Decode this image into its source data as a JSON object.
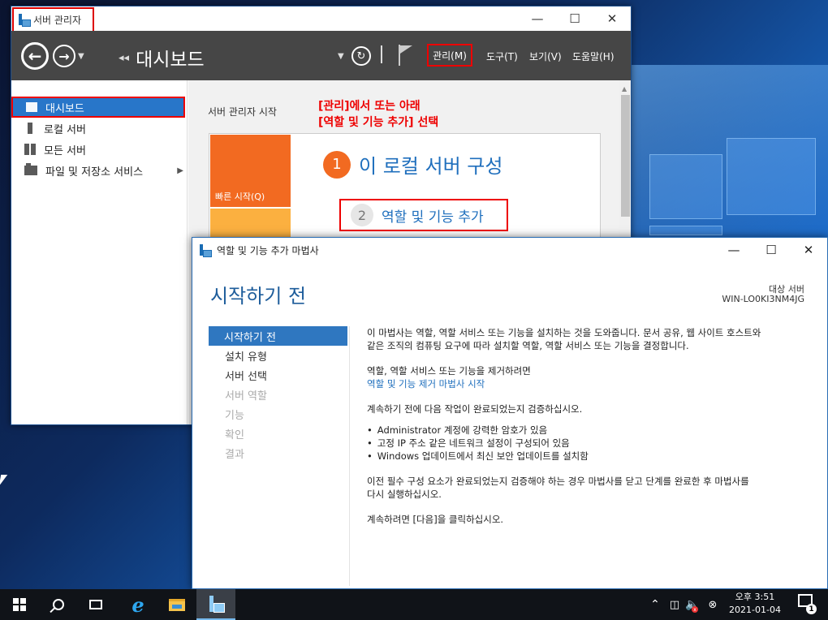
{
  "server_manager": {
    "title": "서버 관리자",
    "breadcrumb_chevron": "◂◂",
    "breadcrumb": "대시보드",
    "menus": [
      {
        "label": "관리(M)"
      },
      {
        "label": "도구(T)"
      },
      {
        "label": "보기(V)"
      },
      {
        "label": "도움말(H)"
      }
    ],
    "sidebar": [
      {
        "label": "대시보드",
        "icon": "dashboard-icon",
        "active": true
      },
      {
        "label": "로컬 서버",
        "icon": "local-server-icon"
      },
      {
        "label": "모든 서버",
        "icon": "all-servers-icon"
      },
      {
        "label": "파일 및 저장소 서비스",
        "icon": "file-storage-icon",
        "has_arrow": true
      }
    ],
    "quickstart": {
      "section_title": "서버 관리자 시작",
      "tile_label": "빠른 시작(Q)",
      "step1_number": "1",
      "step1_text": "이 로컬 서버 구성",
      "step2_number": "2",
      "step2_text": "역할 및 기능 추가"
    },
    "annotation_line1": "[관리]에서 또는 아래",
    "annotation_line2": "[역할 및 기능 추가] 선택"
  },
  "wizard": {
    "title": "역할 및 기능 추가 마법사",
    "heading": "시작하기 전",
    "target_label": "대상 서버",
    "target_server": "WIN-LO0KI3NM4JG",
    "steps": [
      {
        "label": "시작하기 전",
        "state": "active"
      },
      {
        "label": "설치 유형",
        "state": "enabled"
      },
      {
        "label": "서버 선택",
        "state": "enabled"
      },
      {
        "label": "서버 역할",
        "state": "disabled"
      },
      {
        "label": "기능",
        "state": "disabled"
      },
      {
        "label": "확인",
        "state": "disabled"
      },
      {
        "label": "결과",
        "state": "disabled"
      }
    ],
    "body": {
      "intro_line1": "이 마법사는 역할, 역할 서비스 또는 기능을 설치하는 것을 도와줍니다. 문서 공유, 웹 사이트 호스트와",
      "intro_line2": "같은 조직의 컴퓨팅 요구에 따라 설치할 역할, 역할 서비스 또는 기능을 결정합니다.",
      "remove_text": "역할, 역할 서비스 또는 기능을 제거하려면",
      "remove_link": "역할 및 기능 제거 마법사 시작",
      "verify_text": "계속하기 전에 다음 작업이 완료되었는지 검증하십시오.",
      "bullets": [
        "Administrator 계정에 강력한 암호가 있음",
        "고정 IP 주소 같은 네트워크 설정이 구성되어 있음",
        "Windows 업데이트에서 최신 보안 업데이트를 설치함"
      ],
      "prereq_line1": "이전 필수 구성 요소가 완료되었는지 검증해야 하는 경우 마법사를 닫고 단계를 완료한 후 마법사를",
      "prereq_line2": "다시 실행하십시오.",
      "continue_text": "계속하려면 [다음]을 클릭하십시오."
    }
  },
  "taskbar": {
    "clock_time": "오후 3:51",
    "clock_date": "2021-01-04",
    "notification_count": "1"
  },
  "colors": {
    "accent_blue": "#2876c9",
    "highlight_red": "#e00000",
    "quickstart_orange": "#f26a21",
    "quickstart_yellow": "#fbb040",
    "link_blue": "#1f6fbd"
  }
}
